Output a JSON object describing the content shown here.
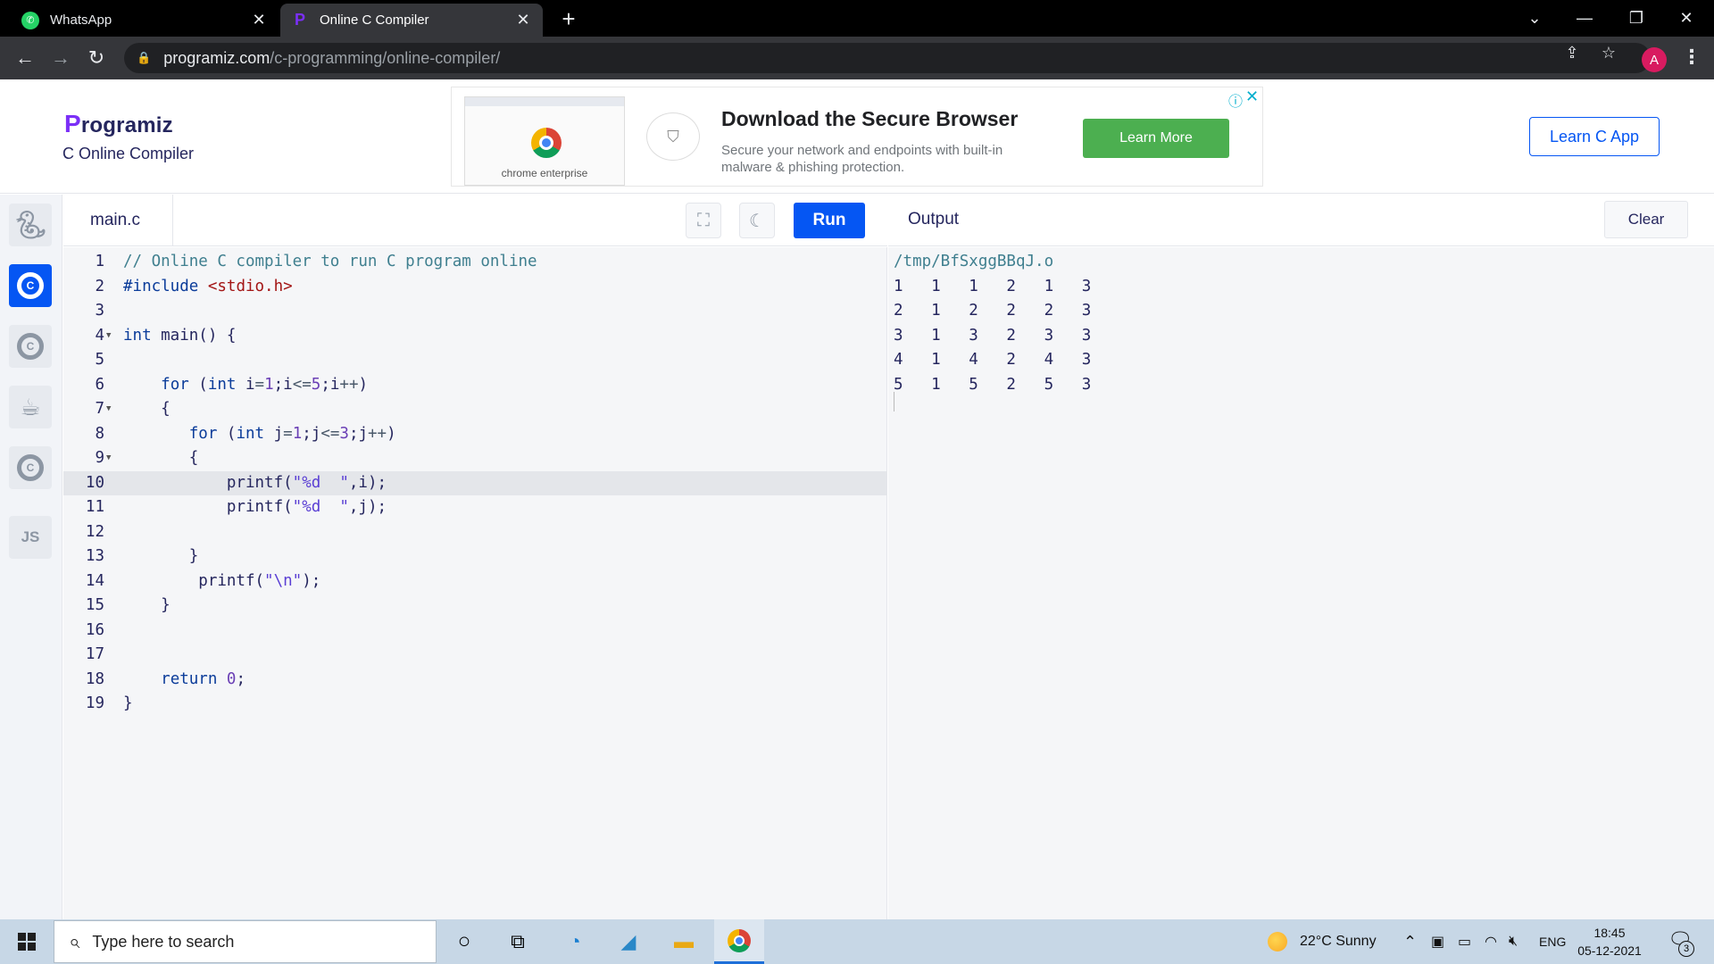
{
  "browser": {
    "tabs": [
      {
        "title": "WhatsApp",
        "active": false
      },
      {
        "title": "Online C Compiler",
        "active": true
      }
    ],
    "url_host": "programiz.com",
    "url_path": "/c-programming/online-compiler/",
    "profile_initial": "A"
  },
  "site": {
    "logo_text": "rogramiz",
    "logo_letter": "P",
    "subtitle": "C Online Compiler",
    "learn_app_label": "Learn C App"
  },
  "ad": {
    "thumb_label": "chrome enterprise",
    "headline": "Download the Secure Browser",
    "description": "Secure your network and endpoints with built-in malware & phishing protection.",
    "cta": "Learn More"
  },
  "sidebar": {
    "languages": [
      {
        "icon": "python-icon",
        "active": false
      },
      {
        "icon": "c-icon",
        "active": true
      },
      {
        "icon": "cpp-icon",
        "active": false
      },
      {
        "icon": "java-icon",
        "active": false
      },
      {
        "icon": "csharp-icon",
        "active": false
      },
      {
        "icon": "javascript-icon",
        "label": "JS",
        "active": false
      }
    ]
  },
  "editor": {
    "filename": "main.c",
    "run_label": "Run",
    "highlighted_line": 10,
    "lines": [
      {
        "n": "1",
        "fold": false,
        "code": "// Online C compiler to run C program online"
      },
      {
        "n": "2",
        "fold": false,
        "code": "#include <stdio.h>"
      },
      {
        "n": "3",
        "fold": false,
        "code": ""
      },
      {
        "n": "4",
        "fold": true,
        "code": "int main() {"
      },
      {
        "n": "5",
        "fold": false,
        "code": ""
      },
      {
        "n": "6",
        "fold": false,
        "code": "    for (int i=1;i<=5;i++)"
      },
      {
        "n": "7",
        "fold": true,
        "code": "    {"
      },
      {
        "n": "8",
        "fold": false,
        "code": "       for (int j=1;j<=3;j++)"
      },
      {
        "n": "9",
        "fold": true,
        "code": "       {"
      },
      {
        "n": "10",
        "fold": false,
        "code": "           printf(\"%d  \",i);"
      },
      {
        "n": "11",
        "fold": false,
        "code": "           printf(\"%d  \",j);"
      },
      {
        "n": "12",
        "fold": false,
        "code": ""
      },
      {
        "n": "13",
        "fold": false,
        "code": "       }"
      },
      {
        "n": "14",
        "fold": false,
        "code": "        printf(\"\\n\");"
      },
      {
        "n": "15",
        "fold": false,
        "code": "    }"
      },
      {
        "n": "16",
        "fold": false,
        "code": ""
      },
      {
        "n": "17",
        "fold": false,
        "code": ""
      },
      {
        "n": "18",
        "fold": false,
        "code": "    return 0;"
      },
      {
        "n": "19",
        "fold": false,
        "code": "}"
      }
    ]
  },
  "output": {
    "title": "Output",
    "clear_label": "Clear",
    "path": "/tmp/BfSxggBBqJ.o",
    "lines": [
      "1   1   1   2   1   3",
      "2   1   2   2   2   3",
      "3   1   3   2   3   3",
      "4   1   4   2   4   3",
      "5   1   5   2   5   3"
    ]
  },
  "taskbar": {
    "search_placeholder": "Type here to search",
    "weather": "22°C  Sunny",
    "language": "ENG",
    "time": "18:45",
    "date": "05-12-2021",
    "notification_count": "3"
  },
  "colors": {
    "brand_blue": "#0556f3",
    "ad_cta_green": "#4caf50",
    "logo_purple": "#7b2ff7"
  }
}
